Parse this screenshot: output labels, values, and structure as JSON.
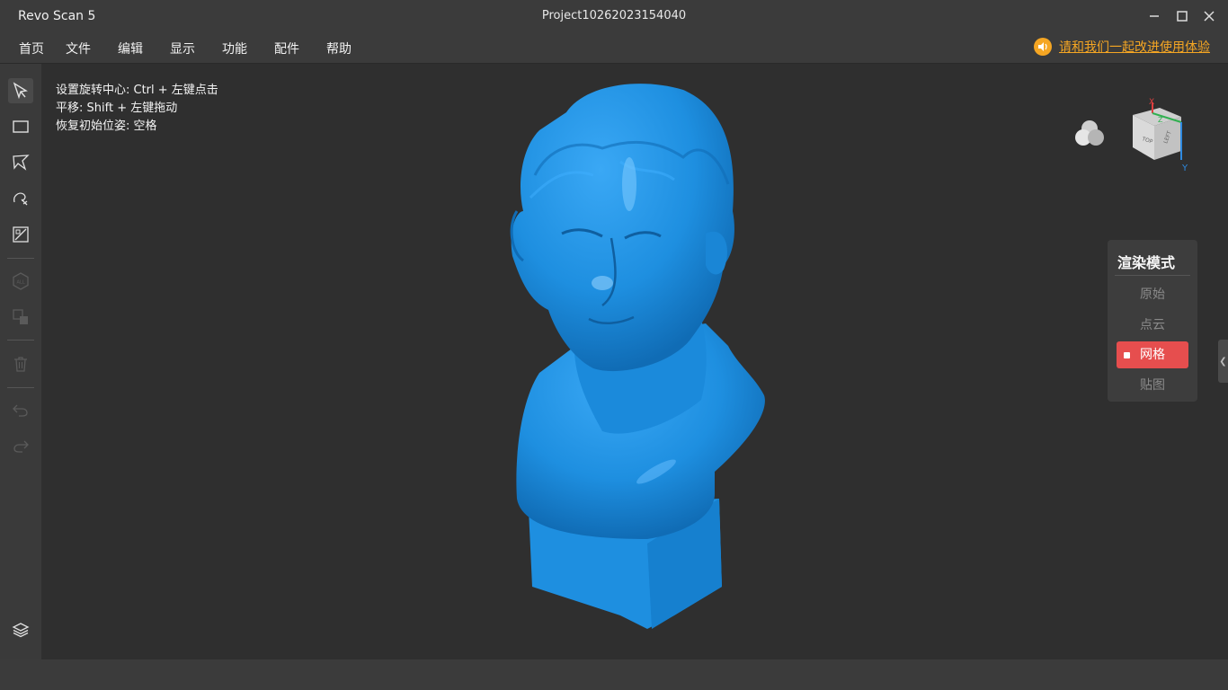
{
  "window": {
    "app_title": "Revo Scan 5",
    "project_title": "Project10262023154040"
  },
  "menu": [
    "首页",
    "文件",
    "编辑",
    "显示",
    "功能",
    "配件",
    "帮助"
  ],
  "feedback": {
    "text": "请和我们一起改进使用体验",
    "icon": "speaker-icon",
    "color": "#f5a623"
  },
  "toolbar": {
    "tools": [
      {
        "name": "select-pointer-icon",
        "enabled": true
      },
      {
        "name": "rectangle-select-icon",
        "enabled": true
      },
      {
        "name": "lasso-select-icon",
        "enabled": true
      },
      {
        "name": "brush-select-icon",
        "enabled": true
      },
      {
        "name": "invert-select-icon",
        "enabled": true
      },
      {
        "name": "select-all-icon",
        "enabled": false
      },
      {
        "name": "select-connected-icon",
        "enabled": false
      },
      {
        "name": "delete-icon",
        "enabled": false
      },
      {
        "name": "undo-icon",
        "enabled": false
      },
      {
        "name": "redo-icon",
        "enabled": false
      }
    ],
    "bottom_tool": "layers-icon"
  },
  "hints": [
    "设置旋转中心: Ctrl + 左键点击",
    "平移: Shift + 左键拖动",
    "恢复初始位姿: 空格"
  ],
  "render_mode": {
    "title": "渲染模式",
    "options": [
      "原始",
      "点云",
      "网格",
      "贴图"
    ],
    "selected": "网格",
    "accent": "#e64e4e"
  },
  "nav_cube": {
    "faces": [
      "TOP",
      "LEFT"
    ],
    "axes": [
      "X",
      "Y",
      "Z"
    ]
  },
  "model": {
    "color": "#1e8fe0"
  }
}
